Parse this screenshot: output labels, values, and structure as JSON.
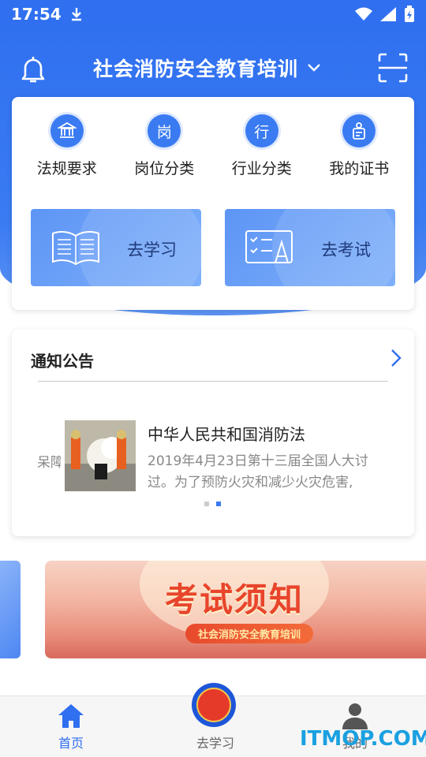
{
  "status": {
    "time": "17:54"
  },
  "header": {
    "title": "社会消防安全教育培训"
  },
  "categories": [
    {
      "label": "法规要求",
      "glyph": ""
    },
    {
      "label": "岗位分类",
      "glyph": "岗"
    },
    {
      "label": "行业分类",
      "glyph": "行"
    },
    {
      "label": "我的证书",
      "glyph": ""
    }
  ],
  "actions": {
    "study": "去学习",
    "exam": "去考试"
  },
  "notice": {
    "title": "通知公告",
    "ghost": "呆障 吾…",
    "news_title": "中华人民共和国消防法",
    "news_line1": "2019年4月23日第十三届全国人大讨",
    "news_line2": "过。为了预防火灾和减少火灾危害,"
  },
  "banner": {
    "title": "考试须知",
    "subtitle": "社会消防安全教育培训"
  },
  "tabs": {
    "home": "首页",
    "study": "去学习",
    "mine": "我的"
  },
  "watermark": "ITMOP.COM",
  "colors": {
    "primary": "#2f6ff0",
    "accent": "#e8452c"
  }
}
